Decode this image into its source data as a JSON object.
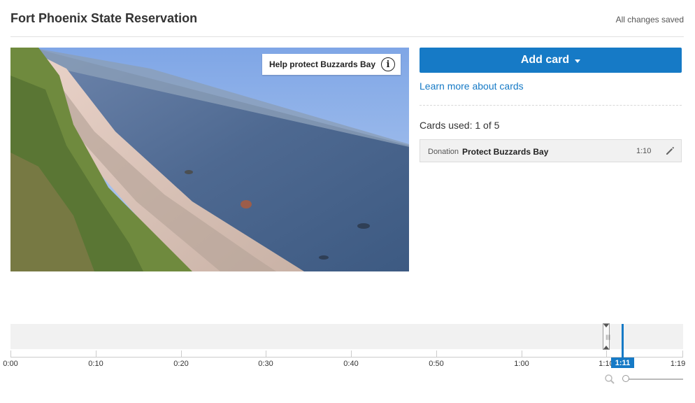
{
  "header": {
    "title": "Fort Phoenix State Reservation",
    "status": "All changes saved"
  },
  "video": {
    "teaser_text": "Help protect Buzzards Bay",
    "teaser_icon": "info-icon"
  },
  "panel": {
    "add_card_label": "Add card",
    "learn_more": "Learn more about cards",
    "cards_used": "Cards used: 1 of 5",
    "cards": [
      {
        "type": "Donation",
        "title": "Protect Buzzards Bay",
        "time": "1:10"
      }
    ]
  },
  "timeline": {
    "ticks": [
      "0:00",
      "0:10",
      "0:20",
      "0:30",
      "0:40",
      "0:50",
      "1:00",
      "1:10",
      "1:19"
    ],
    "playhead_time": "1:11",
    "zoom_icon": "search-icon"
  },
  "colors": {
    "accent": "#167ac6",
    "track": "#f1f1f1"
  }
}
